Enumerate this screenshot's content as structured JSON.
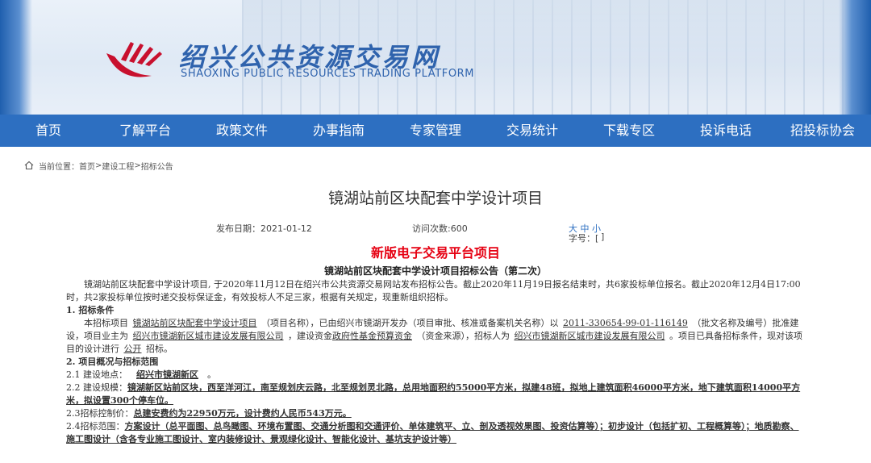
{
  "header": {
    "title": "绍兴公共资源交易网",
    "subtitle": "SHAOXING PUBLIC RESOURCES TRADING PLATFORM"
  },
  "nav": [
    "首页",
    "了解平台",
    "政策文件",
    "办事指南",
    "专家管理",
    "交易统计",
    "下载专区",
    "投诉电话",
    "招投标协会"
  ],
  "breadcrumb": {
    "prefix": "当前位置：",
    "home": "首页",
    "sep": ">",
    "l2": "建设工程",
    "l3": "招标公告"
  },
  "article": {
    "title": "镜湖站前区块配套中学设计项目",
    "date": "发布日期：2021-01-12",
    "visits": "访问次数:600",
    "font_label": "字号：[",
    "font_big": "大",
    "font_mid": "中",
    "font_small": "小",
    "font_end": "]"
  },
  "notice": {
    "banner": "新版电子交易平台项目",
    "heading": "镜湖站前区块配套中学设计项目招标公告（第二次）",
    "intro": "镜湖站前区块配套中学设计项目, 于2020年11月12日在绍兴市公共资源交易网站发布招标公告。截止2020年11月19日报名结束时，共6家投标单位报名。截止2020年12月4日17:00时，共2家投标单位按时递交投标保证金，有效投标人不足三家，根据有关规定，现重新组织招标。",
    "s1": "1. 招标条件",
    "s1_a": "本招标项目",
    "s1_name": "镜湖站前区块配套中学设计项目",
    "s1_b": "（项目名称），已由绍兴市镜湖开发办（项目审批、核准或备案机关名称）以",
    "s1_code": "2011-330654-99-01-116149",
    "s1_c": "（批文名称及编号）批准建设，项目业主为",
    "s1_owner": "绍兴市镜湖新区城市建设发展有限公司",
    "s1_d": "，建设资金",
    "s1_fund": "政府性基金预算资金",
    "s1_e": "（资金来源），招标人为",
    "s1_tenderer": "绍兴市镜湖新区城市建设发展有限公司",
    "s1_f": "。项目已具备招标条件，现对该项目的设计进行",
    "s1_method": "公开",
    "s1_g": "招标。",
    "s2": "2. 项目概况与招标范围",
    "s21_label": "2.1 建设地点：",
    "s21_val": "绍兴市镜湖新区",
    "s21_end": "。",
    "s22_label": "2.2 建设规模：",
    "s22_val": "镜湖新区站前区块，西至洋河江，南至规划庆云路，北至规划灵北路，总用地面积约55000平方米，拟建48班，拟地上建筑面积46000平方米，地下建筑面积14000平方米，拟设置300个停车位。",
    "s23_label": "2.3招标控制价：",
    "s23_val": "总建安费约为22950万元，设计费约人民币543万元。",
    "s24_label": "2.4招标范围：",
    "s24_val": "方案设计（总平面图、总鸟瞰图、环境布置图、交通分析图和交通评价、单体建筑平、立、剖及透视效果图、投资估算等）；初步设计（包括扩初、工程概算等）；地质勘察、施工图设计（含各专业施工图设计、室内装修设计、景观绿化设计、智能化设计、基坑支护设计等）"
  },
  "colors": {
    "brand_blue": "#2d6fc1",
    "banner_red": "#e60012",
    "logo_red": "#c8102e"
  }
}
